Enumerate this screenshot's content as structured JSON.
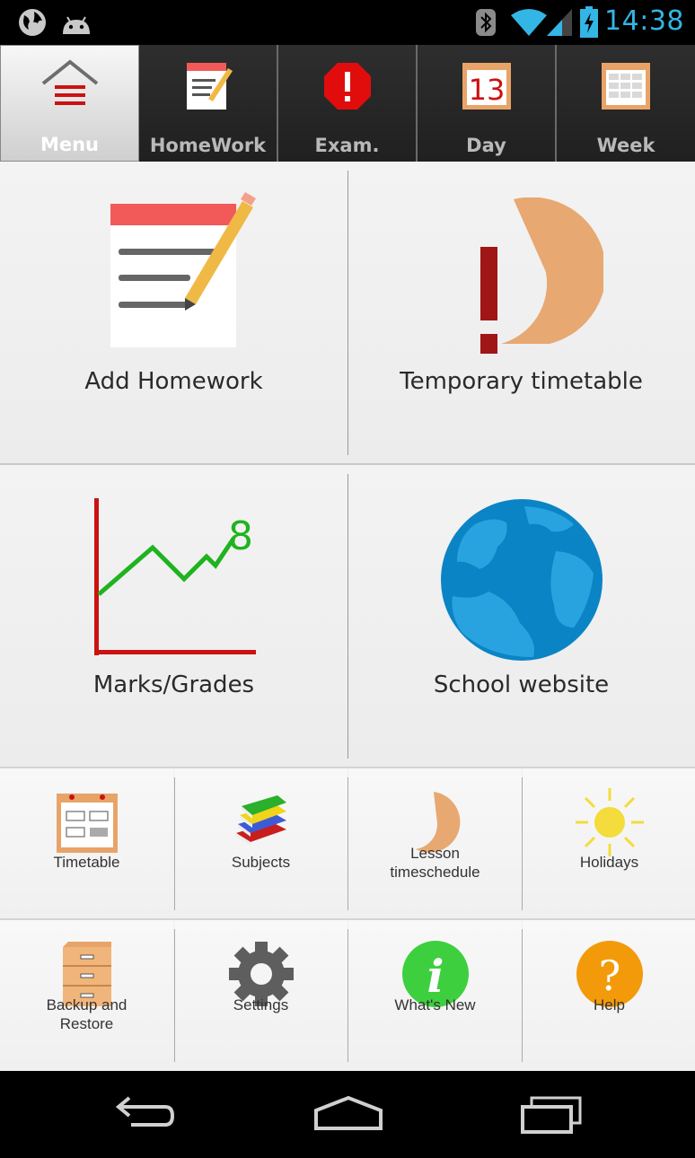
{
  "status_bar": {
    "time": "14:38",
    "icons": [
      "globe-icon",
      "android-debug-icon",
      "bluetooth-icon",
      "wifi-icon",
      "signal-icon",
      "battery-charging-icon"
    ],
    "accent_color": "#33b5e5"
  },
  "tabs": [
    {
      "label": "Menu",
      "icon": "home-menu-icon",
      "active": true
    },
    {
      "label": "HomeWork",
      "icon": "notepad-icon",
      "active": false
    },
    {
      "label": "Exam.",
      "icon": "exam-alert-icon",
      "active": false
    },
    {
      "label": "Day",
      "icon": "calendar-day-icon",
      "active": false
    },
    {
      "label": "Week",
      "icon": "calendar-week-icon",
      "active": false
    }
  ],
  "main_tiles": [
    {
      "label": "Add Homework",
      "icon": "notepad-pencil-icon"
    },
    {
      "label": "Temporary timetable",
      "icon": "temporary-timetable-icon"
    },
    {
      "label": "Marks/Grades",
      "icon": "grades-chart-icon"
    },
    {
      "label": "School website",
      "icon": "globe-icon"
    }
  ],
  "grade_example": "8",
  "small_tiles": [
    {
      "label": "Timetable",
      "label2": "",
      "icon": "timetable-icon"
    },
    {
      "label": "Subjects",
      "label2": "",
      "icon": "books-icon"
    },
    {
      "label": "Lesson",
      "label2": "timeschedule",
      "icon": "pie-clock-icon"
    },
    {
      "label": "Holidays",
      "label2": "",
      "icon": "sun-icon"
    },
    {
      "label": "Backup and",
      "label2": "Restore",
      "icon": "filing-cabinet-icon"
    },
    {
      "label": "Settings",
      "label2": "",
      "icon": "gear-icon"
    },
    {
      "label": "What's New",
      "label2": "",
      "icon": "info-icon"
    },
    {
      "label": "Help",
      "label2": "",
      "icon": "help-icon"
    }
  ],
  "calendar_day_number": "13",
  "nav_bar": {
    "buttons": [
      "back-button",
      "home-button",
      "recents-button"
    ]
  },
  "colors": {
    "brand_red": "#cc1111",
    "info_green": "#3ecf3e",
    "help_orange": "#f39a0a",
    "globe_blue": "#1e8fd0"
  }
}
